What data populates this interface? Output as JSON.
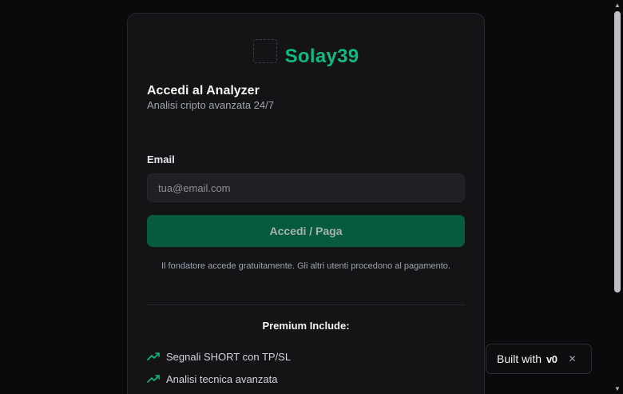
{
  "brand": {
    "logo_alt": "",
    "name": "Solay39"
  },
  "login": {
    "title": "Accedi al Analyzer",
    "subtitle": "Analisi cripto avanzata 24/7",
    "email_label": "Email",
    "email_placeholder": "tua@email.com",
    "email_value": "",
    "submit_label": "Accedi / Paga",
    "note": "Il fondatore accede gratuitamente. Gli altri utenti procedono al pagamento."
  },
  "premium": {
    "title": "Premium Include:",
    "features": [
      {
        "label": "Segnali SHORT con TP/SL",
        "icon": "trending-up-icon"
      },
      {
        "label": "Analisi tecnica avanzata",
        "icon": "trending-up-icon"
      },
      {
        "label": "",
        "icon": "trending-up-icon"
      }
    ]
  },
  "badge": {
    "label": "Built with",
    "logo": "v0",
    "close_icon": "close-icon"
  },
  "colors": {
    "accent": "#10b981",
    "button": "#065a40",
    "background": "#0a0a0c",
    "card": "#141416"
  }
}
